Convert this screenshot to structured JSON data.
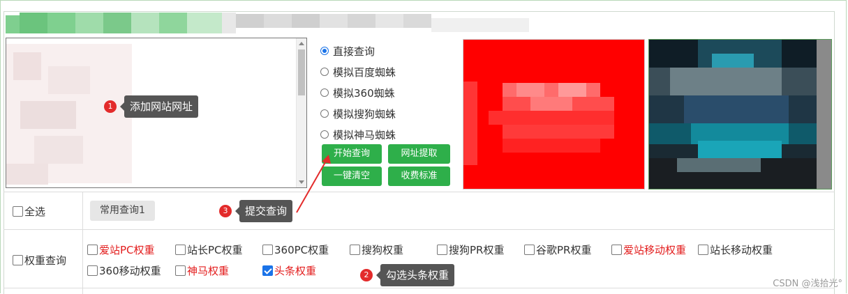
{
  "radios": [
    {
      "label": "直接查询",
      "checked": true
    },
    {
      "label": "模拟百度蜘蛛",
      "checked": false
    },
    {
      "label": "模拟360蜘蛛",
      "checked": false
    },
    {
      "label": "模拟搜狗蜘蛛",
      "checked": false
    },
    {
      "label": "模拟神马蜘蛛",
      "checked": false
    }
  ],
  "buttons": {
    "start": "开始查询",
    "extract": "网址提取",
    "clear": "一键清空",
    "pricing": "收费标准"
  },
  "select_all": "全选",
  "preset_tag": "常用查询1",
  "weight_query": "权重查询",
  "weight_options": [
    {
      "label": "爱站PC权重",
      "red": true,
      "checked": false
    },
    {
      "label": "站长PC权重",
      "red": false,
      "checked": false
    },
    {
      "label": "360PC权重",
      "red": false,
      "checked": false
    },
    {
      "label": "搜狗权重",
      "red": false,
      "checked": false
    },
    {
      "label": "搜狗PR权重",
      "red": false,
      "checked": false
    },
    {
      "label": "谷歌PR权重",
      "red": false,
      "checked": false
    },
    {
      "label": "爱站移动权重",
      "red": true,
      "checked": false
    },
    {
      "label": "站长移动权重",
      "red": false,
      "checked": false
    },
    {
      "label": "360移动权重",
      "red": false,
      "checked": false
    },
    {
      "label": "神马权重",
      "red": true,
      "checked": false
    },
    {
      "label": "头条权重",
      "red": true,
      "checked": true
    }
  ],
  "annotations": {
    "step1": {
      "num": "1",
      "text": "添加网站网址"
    },
    "step2": {
      "num": "2",
      "text": "勾选头条权重"
    },
    "step3": {
      "num": "3",
      "text": "提交查询"
    }
  },
  "watermark": "CSDN @浅拾光°",
  "colors": {
    "button_green": "#2eaf4a",
    "annotation_red": "#e32b2b",
    "tooltip_gray": "#555555",
    "option_red": "#e31d1d"
  }
}
